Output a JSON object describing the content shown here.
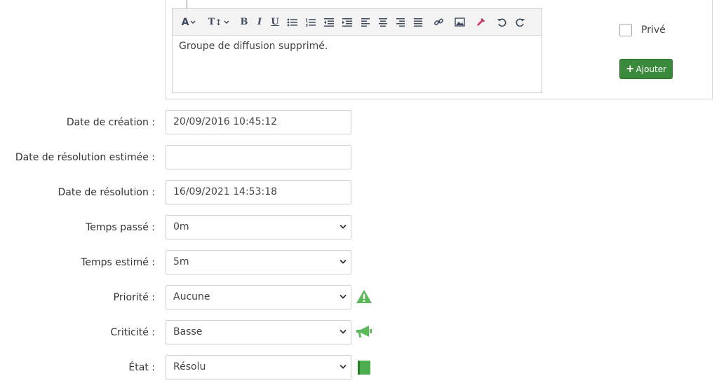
{
  "editor": {
    "toolbar": [
      {
        "name": "font-color-icon",
        "glyph": "A"
      },
      {
        "name": "font-size-icon",
        "glyph": "T↕"
      },
      {
        "name": "bold-icon",
        "glyph": "B"
      },
      {
        "name": "italic-icon",
        "glyph": "I"
      },
      {
        "name": "underline-icon",
        "glyph": "U"
      },
      {
        "name": "bullet-list-icon"
      },
      {
        "name": "numbered-list-icon"
      },
      {
        "name": "outdent-icon"
      },
      {
        "name": "indent-icon"
      },
      {
        "name": "align-left-icon"
      },
      {
        "name": "align-center-icon"
      },
      {
        "name": "align-right-icon"
      },
      {
        "name": "justify-icon"
      },
      {
        "name": "link-icon"
      },
      {
        "name": "image-icon"
      },
      {
        "name": "eyedropper-icon"
      },
      {
        "name": "undo-icon"
      },
      {
        "name": "redo-icon"
      }
    ],
    "content": "Groupe de diffusion supprimé."
  },
  "private": {
    "label": "Privé",
    "checked": false
  },
  "add_button": {
    "label": "Ajouter"
  },
  "fields": {
    "creation_date": {
      "label": "Date de création :",
      "value": "20/09/2016 10:45:12"
    },
    "estimated_resolution_date": {
      "label": "Date de résolution estimée :",
      "value": ""
    },
    "resolution_date": {
      "label": "Date de résolution :",
      "value": "16/09/2021 14:53:18"
    },
    "time_spent": {
      "label": "Temps passé :",
      "value": "0m"
    },
    "estimated_time": {
      "label": "Temps estimé :",
      "value": "5m"
    },
    "priority": {
      "label": "Priorité :",
      "value": "Aucune",
      "icon": "warning-icon",
      "icon_color": "#5cb85c"
    },
    "criticity": {
      "label": "Criticité :",
      "value": "Basse",
      "icon": "megaphone-icon",
      "icon_color": "#5cb85c"
    },
    "state": {
      "label": "État :",
      "value": "Résolu",
      "icon": "book-icon",
      "icon_color": "#4cae4c"
    }
  }
}
